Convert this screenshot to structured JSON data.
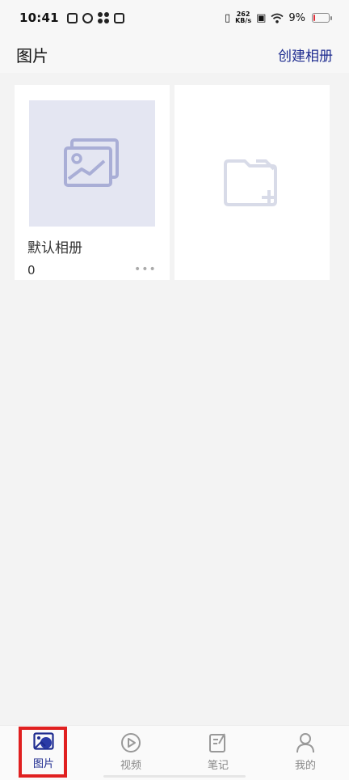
{
  "status_bar": {
    "time": "10:41",
    "speed_value": "262",
    "speed_unit": "KB/s",
    "battery_text": "9%",
    "battery_level_percent": 9
  },
  "header": {
    "title": "图片",
    "create_album_label": "创建相册"
  },
  "albums": [
    {
      "name": "默认相册",
      "count": "0",
      "more_label": "•••"
    }
  ],
  "nav": {
    "items": [
      {
        "label": "图片",
        "icon": "image-icon",
        "active": true
      },
      {
        "label": "视频",
        "icon": "play-icon",
        "active": false
      },
      {
        "label": "笔记",
        "icon": "note-icon",
        "active": false
      },
      {
        "label": "我的",
        "icon": "user-icon",
        "active": false
      }
    ]
  },
  "colors": {
    "accent": "#1d2b8f",
    "highlight_frame": "#e02020",
    "thumb_bg": "#e4e6f2",
    "thumb_icon": "#a9aed6",
    "add_icon": "#d8dbe8"
  }
}
